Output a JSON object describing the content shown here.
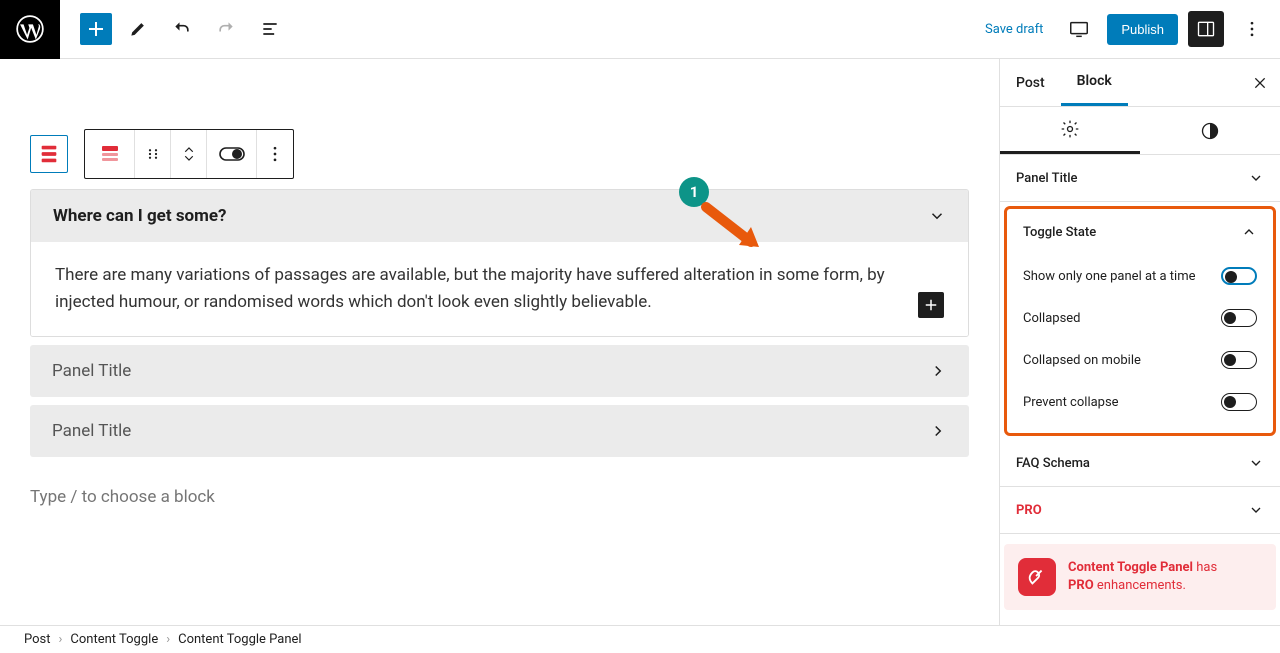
{
  "top": {
    "save_draft": "Save draft",
    "publish": "Publish"
  },
  "editor": {
    "panels": [
      {
        "title": "Where can I get some?",
        "body": "There are many variations of passages are available, but the majority have suffered alteration in some form, by injected humour, or randomised words which don't look even slightly believable."
      },
      {
        "title": "Panel Title"
      },
      {
        "title": "Panel Title"
      }
    ],
    "placeholder": "Type / to choose a block"
  },
  "sidebar": {
    "tabs": {
      "post": "Post",
      "block": "Block"
    },
    "sections": {
      "panel_title": "Panel Title",
      "toggle_state": "Toggle State",
      "faq_schema": "FAQ Schema",
      "pro": "PRO"
    },
    "toggles": {
      "one_panel": "Show only one panel at a time",
      "collapsed": "Collapsed",
      "collapsed_mobile": "Collapsed on mobile",
      "prevent_collapse": "Prevent collapse"
    },
    "pro_banner": {
      "name": "Content Toggle Panel",
      "has": " has ",
      "pro": "PRO",
      "enh": " enhancements."
    }
  },
  "breadcrumb": [
    "Post",
    "Content Toggle",
    "Content Toggle Panel"
  ],
  "annotation": {
    "num": "1"
  }
}
